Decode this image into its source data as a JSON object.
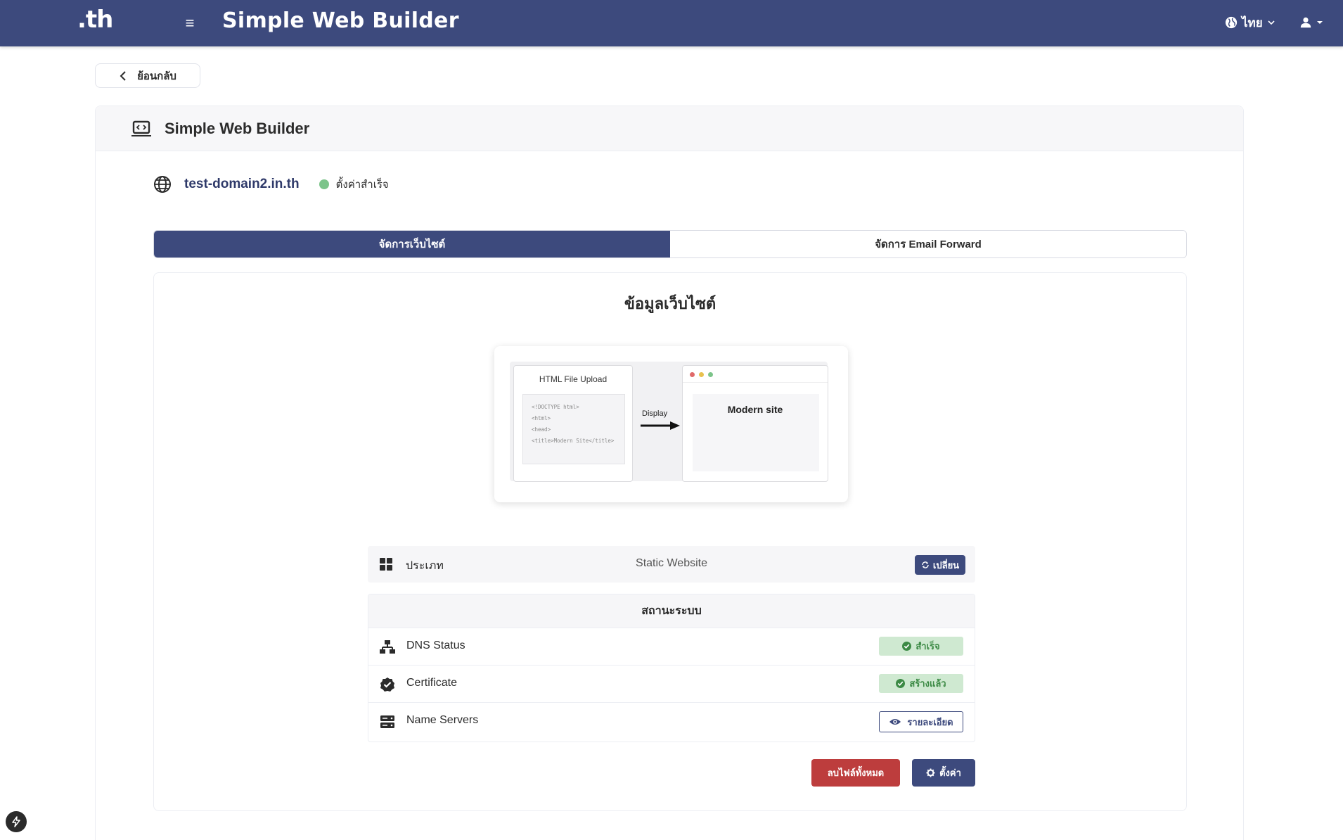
{
  "header": {
    "logo": ".th",
    "app_title": "Simple Web Builder",
    "language": "ไทย",
    "bg_color": "#3d4a7d"
  },
  "back_label": "ย้อนกลับ",
  "card": {
    "title": "Simple Web Builder",
    "domain": "test-domain2.in.th",
    "domain_status": "ตั้งค่าสำเร็จ",
    "status_color": "#7cc48a"
  },
  "tabs": [
    {
      "label": "จัดการเว็บไซต์",
      "active": true
    },
    {
      "label": "จัดการ Email Forward",
      "active": false
    }
  ],
  "website_info": {
    "title": "ข้อมูลเว็บไซต์",
    "illustration": {
      "upload_title": "HTML File Upload",
      "code_lines": [
        "<!DOCTYPE html>",
        "<html>",
        "<head>",
        "<title>Modern Site</title>"
      ],
      "arrow_label": "Display",
      "preview_title": "Modern site"
    },
    "type": {
      "label": "ประเภท",
      "value": "Static Website",
      "change_label": "เปลี่ยน"
    },
    "system_status": {
      "title": "สถานะระบบ",
      "rows": [
        {
          "label": "DNS Status",
          "badge": "สำเร็จ",
          "icon": "sitemap-icon"
        },
        {
          "label": "Certificate",
          "badge": "สร้างแล้ว",
          "icon": "certificate-check-icon"
        },
        {
          "label": "Name Servers",
          "button": "รายละเอียด",
          "icon": "server-icon"
        }
      ]
    }
  },
  "actions": {
    "delete_label": "ลบไฟล์ทั้งหมด",
    "settings_label": "ตั้งค่า",
    "delete_color": "#bd3d3d",
    "primary_color": "#3d4a7d",
    "success_bg": "#cfe9d1",
    "success_text": "#3c8a45"
  }
}
